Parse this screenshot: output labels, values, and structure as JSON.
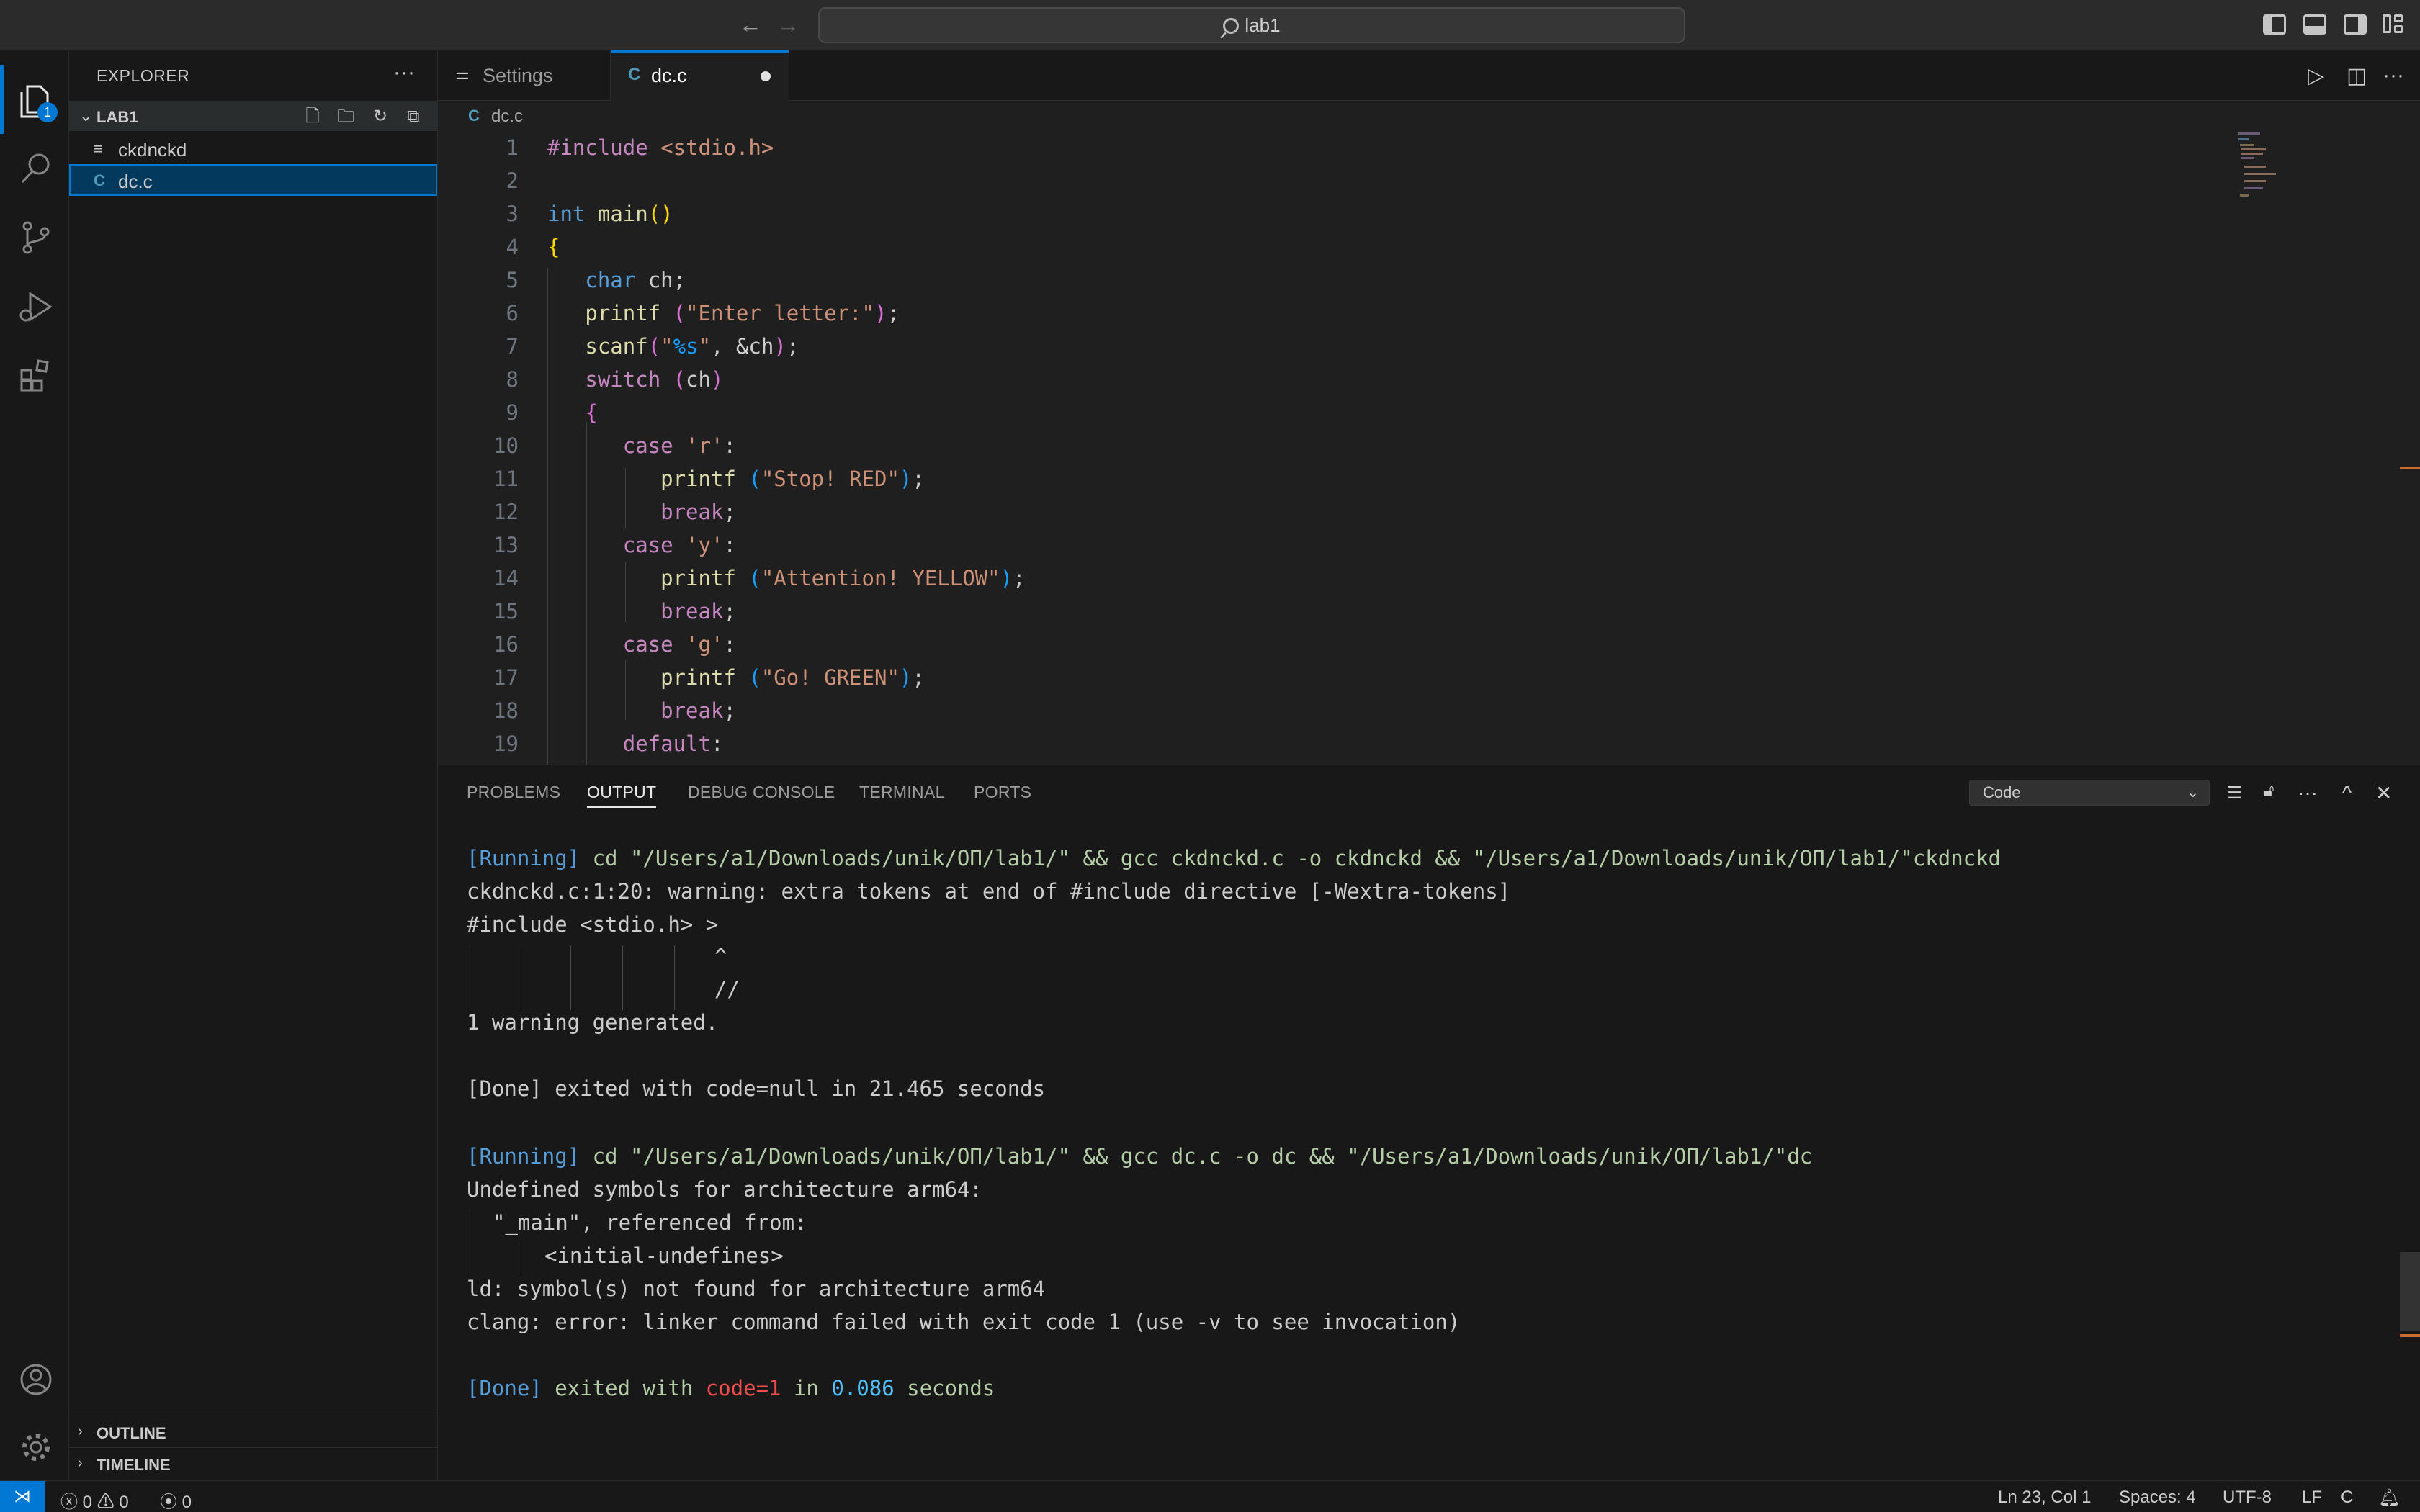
{
  "titlebar": {
    "search_text": "lab1"
  },
  "activity": {
    "explorer_badge": "1"
  },
  "sidebar": {
    "title": "EXPLORER",
    "folder": "LAB1",
    "files": [
      {
        "name": "ckdnckd",
        "icon": "plain-file-icon"
      },
      {
        "name": "dc.c",
        "icon": "c-file-icon"
      }
    ],
    "sections": {
      "outline": "OUTLINE",
      "timeline": "TIMELINE"
    }
  },
  "tabs": {
    "settings": "Settings",
    "dc": "dc.c"
  },
  "breadcrumb": {
    "file": "dc.c",
    "icon_letter": "C"
  },
  "code": {
    "line_numbers": [
      "1",
      "2",
      "3",
      "4",
      "5",
      "6",
      "7",
      "8",
      "9",
      "10",
      "11",
      "12",
      "13",
      "14",
      "15",
      "16",
      "17",
      "18",
      "19"
    ]
  },
  "panel": {
    "tabs": [
      "PROBLEMS",
      "OUTPUT",
      "DEBUG CONSOLE",
      "TERMINAL",
      "PORTS"
    ],
    "active_tab": "OUTPUT",
    "channel": "Code",
    "output": {
      "run1_tag": "[Running]",
      "run1_cmd": " cd \"/Users/a1/Downloads/unik/ОП/lab1/\" && gcc ckdnckd.c -o ckdnckd && \"/Users/a1/Downloads/unik/ОП/lab1/\"ckdnckd",
      "warn": "ckdnckd.c:1:20: warning: extra tokens at end of #include directive [-Wextra-tokens]",
      "incl": "#include <stdio.h> >",
      "caret": "^",
      "slashes": "//",
      "gen": "1 warning generated.",
      "done1": "[Done] exited with code=null in 21.465 seconds",
      "run2_tag": "[Running]",
      "run2_cmd": " cd \"/Users/a1/Downloads/unik/ОП/lab1/\" && gcc dc.c -o dc && \"/Users/a1/Downloads/unik/ОП/lab1/\"dc",
      "undef": "Undefined symbols for architecture arm64:",
      "main_ref": "\"_main\", referenced from:",
      "initial": "<initial-undefines>",
      "ld": "ld: symbol(s) not found for architecture arm64",
      "clang": "clang: error: linker command failed with exit code 1 (use -v to see invocation)",
      "done2_tag": "[Done]",
      "done2_a": " exited with ",
      "done2_code": "code=1",
      "done2_b": " in ",
      "done2_secs": "0.086",
      "done2_c": " seconds"
    }
  },
  "status": {
    "errors": "0",
    "warnings": "0",
    "ports": "0",
    "position": "Ln 23, Col 1",
    "spaces": "Spaces: 4",
    "encoding": "UTF-8",
    "eol": "LF",
    "language": "C"
  },
  "colors": {
    "accent": "#0078d4",
    "c_icon": "#519aba",
    "error_red": "#f14c4c"
  }
}
